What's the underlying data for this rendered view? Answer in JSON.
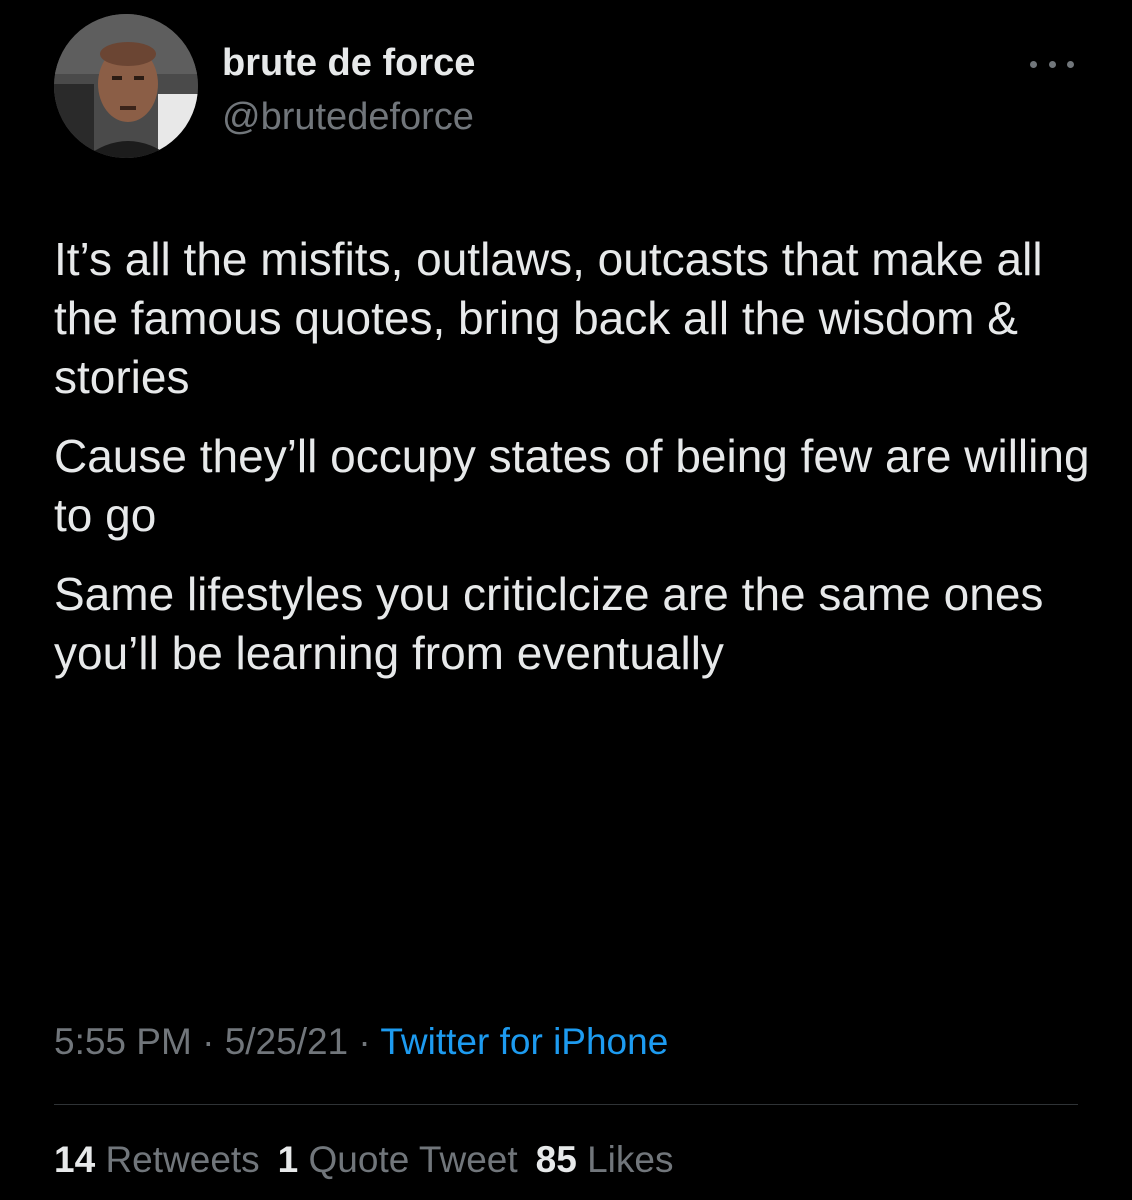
{
  "user": {
    "display_name": "brute de force",
    "handle": "@brutedeforce"
  },
  "tweet": {
    "paragraphs": [
      "It’s all the misfits, outlaws, outcasts that make all the famous quotes, bring back all the wisdom & stories",
      "Cause they’ll occupy states of being few are willing to go",
      "Same lifestyles you criticlcize are the same ones you’ll be learning from eventually"
    ],
    "time": "5:55 PM",
    "date": "5/25/21",
    "separator": "·",
    "source": "Twitter for iPhone"
  },
  "stats": {
    "retweets_count": "14",
    "retweets_label": "Retweets",
    "quotes_count": "1",
    "quotes_label": "Quote Tweet",
    "likes_count": "85",
    "likes_label": "Likes"
  },
  "icons": {
    "more": "more-horizontal-icon"
  },
  "colors": {
    "background": "#000000",
    "text": "#e7e9ea",
    "secondary": "#71767b",
    "link": "#1d9bf0"
  }
}
